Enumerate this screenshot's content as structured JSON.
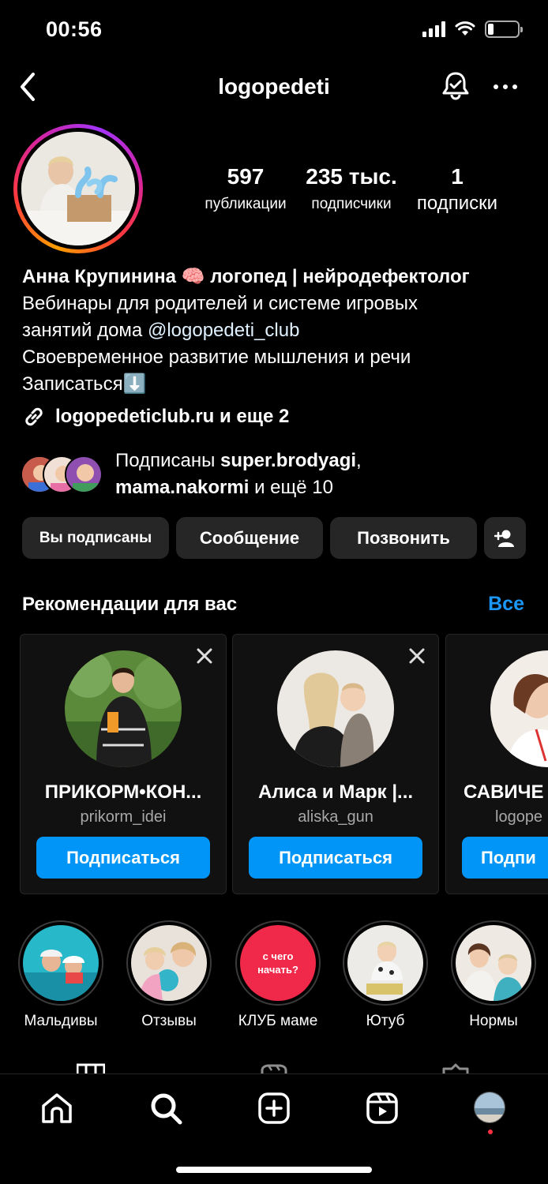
{
  "status_bar": {
    "time": "00:56",
    "battery_level": 0.2
  },
  "header": {
    "username": "logopedeti"
  },
  "stats": [
    {
      "value": "597",
      "label": "публикации"
    },
    {
      "value": "235 тыс.",
      "label": "подписчики"
    },
    {
      "value": "1",
      "label": "подписки"
    }
  ],
  "bio": {
    "name": "Анна Крупинина 🧠 логопед | нейродефектолог",
    "line1": "Вебинары для родителей и системе игровых",
    "line2_prefix": "занятий дома ",
    "mention": "@logopedeti_club",
    "line3": "Своевременное развитие мышления и речи",
    "line4": "Записаться⬇️"
  },
  "link": {
    "text": "logopedeticlub.ru и еще 2"
  },
  "followed_by": {
    "prefix": "Подписаны ",
    "user1": "super.brodyagi",
    "sep": ",",
    "user2": "mama.nakormi",
    "suffix": " и ещё 10"
  },
  "actions": {
    "following_label": "Вы подписаны",
    "message_label": "Сообщение",
    "call_label": "Позвонить"
  },
  "recommendations": {
    "title": "Рекомендации для вас",
    "see_all": "Все",
    "cards": [
      {
        "name": "ПРИКОРМ•КОН...",
        "handle": "prikorm_idei",
        "follow": "Подписаться"
      },
      {
        "name": "Алиса и Марк |...",
        "handle": "aliska_gun",
        "follow": "Подписаться"
      },
      {
        "name": "САВИЧЕ",
        "handle": "logope",
        "follow": "Подпи"
      }
    ]
  },
  "highlights": [
    {
      "label": "Мальдивы"
    },
    {
      "label": "Отзывы"
    },
    {
      "label": "КЛУБ маме",
      "cover_text_1": "с чего",
      "cover_text_2": "начать?"
    },
    {
      "label": "Ютуб"
    },
    {
      "label": "Нормы"
    }
  ],
  "colors": {
    "accent": "#0095f6",
    "link_blue": "#1a97f7",
    "button_bg": "#262626",
    "highlight_red": "#f0284a"
  }
}
